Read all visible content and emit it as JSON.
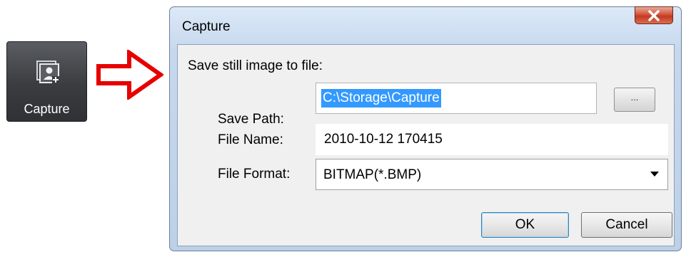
{
  "toolbar": {
    "capture_label": "Capture",
    "capture_icon": "capture-icon"
  },
  "dialog": {
    "title": "Capture",
    "heading": "Save still image to file:",
    "save_path_label": "Save Path:",
    "save_path_value": "C:\\Storage\\Capture",
    "browse_label": "...",
    "file_name_label": "File Name:",
    "file_name_value": "2010-10-12 170415",
    "file_format_label": "File Format:",
    "file_format_value": "BITMAP(*.BMP)",
    "ok_label": "OK",
    "cancel_label": "Cancel"
  },
  "colors": {
    "arrow": "#e60000",
    "selection": "#3399ff",
    "close_button": "#c23a21"
  }
}
